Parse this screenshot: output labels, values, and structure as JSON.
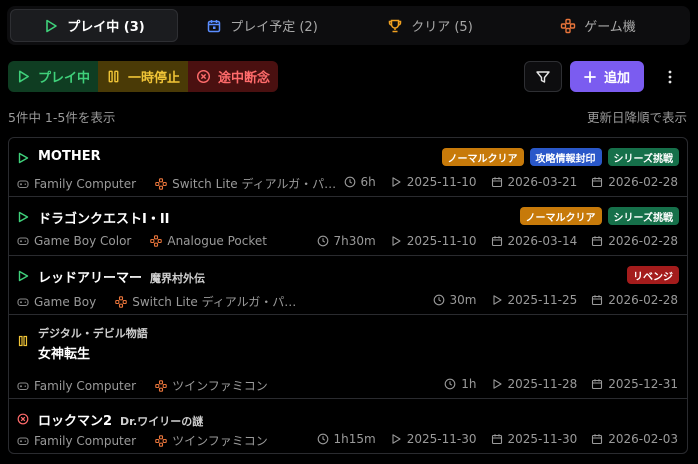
{
  "tabs": [
    {
      "label": "プレイ中 (3)",
      "icon": "play-icon",
      "active": true
    },
    {
      "label": "プレイ予定 (2)",
      "icon": "calendar-icon",
      "active": false
    },
    {
      "label": "クリア (5)",
      "icon": "trophy-icon",
      "active": false
    },
    {
      "label": "ゲーム機",
      "icon": "gamepad-icon",
      "active": false
    }
  ],
  "status_filters": [
    {
      "label": "プレイ中",
      "icon": "play-icon"
    },
    {
      "label": "一時停止",
      "icon": "pause-icon"
    },
    {
      "label": "途中断念",
      "icon": "x-circle-icon"
    }
  ],
  "toolbar": {
    "add_label": "追加"
  },
  "summary": {
    "count_text": "5件中 1-5件を表示",
    "sort_text": "更新日降順で表示"
  },
  "colors": {
    "playing": "#3fd07a",
    "paused": "#f0c437",
    "dropped": "#ff6b6b",
    "accent": "#7b5cf0",
    "console_icon": "#e8743a"
  },
  "games": [
    {
      "status": "playing",
      "pre_title": "",
      "title": "MOTHER",
      "subtitle": "",
      "badges": [
        {
          "label": "ノーマルクリア",
          "color": "#c77a0a"
        },
        {
          "label": "攻略情報封印",
          "color": "#2a58c9"
        },
        {
          "label": "シリーズ挑戦",
          "color": "#16704a"
        }
      ],
      "platform": "Family Computer",
      "device": "Switch Lite ディアルガ・パ…",
      "playtime": "6h",
      "started": "2025-11-10",
      "planned": "2026-03-21",
      "updated": "2026-02-28"
    },
    {
      "status": "playing",
      "pre_title": "",
      "title": "ドラゴンクエストI・II",
      "subtitle": "",
      "badges": [
        {
          "label": "ノーマルクリア",
          "color": "#c77a0a"
        },
        {
          "label": "シリーズ挑戦",
          "color": "#16704a"
        }
      ],
      "platform": "Game Boy Color",
      "device": "Analogue Pocket",
      "playtime": "7h30m",
      "started": "2025-11-10",
      "planned": "2026-03-14",
      "updated": "2026-02-28"
    },
    {
      "status": "playing",
      "pre_title": "",
      "title": "レッドアリーマー",
      "subtitle": "魔界村外伝",
      "badges": [
        {
          "label": "リベンジ",
          "color": "#a41c1c"
        }
      ],
      "platform": "Game Boy",
      "device": "Switch Lite ディアルガ・パ…",
      "playtime": "30m",
      "started": "2025-11-25",
      "planned": "",
      "updated": "2026-02-28"
    },
    {
      "status": "paused",
      "pre_title": "デジタル・デビル物語",
      "title": "女神転生",
      "subtitle": "",
      "badges": [],
      "platform": "Family Computer",
      "device": "ツインファミコン",
      "playtime": "1h",
      "started": "2025-11-28",
      "planned": "",
      "updated": "2025-12-31"
    },
    {
      "status": "dropped",
      "pre_title": "",
      "title": "ロックマン2",
      "subtitle": "Dr.ワイリーの謎",
      "badges": [],
      "platform": "Family Computer",
      "device": "ツインファミコン",
      "playtime": "1h15m",
      "started": "2025-11-30",
      "planned": "2025-11-30",
      "updated": "2026-02-03"
    }
  ]
}
